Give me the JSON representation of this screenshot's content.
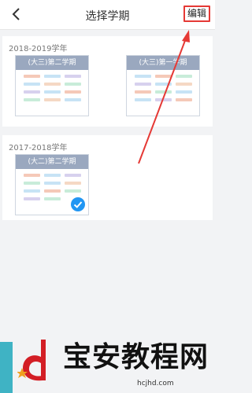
{
  "header": {
    "title": "选择学期",
    "edit_label": "编辑"
  },
  "sections": [
    {
      "year_label": "2018-2019学年",
      "terms": [
        {
          "name": "(大三)第二学期",
          "selected": false
        },
        {
          "name": "(大三)第一学期",
          "selected": false
        }
      ]
    },
    {
      "year_label": "2017-2018学年",
      "terms": [
        {
          "name": "(大二)第二学期",
          "selected": true
        }
      ]
    }
  ],
  "watermark": {
    "text": "宝安教程网",
    "url": "hcjhd.com"
  },
  "colors": {
    "thumb_header": "#9aa8bf",
    "accent_blue": "#2196f3",
    "annotation_red": "#e53935"
  }
}
